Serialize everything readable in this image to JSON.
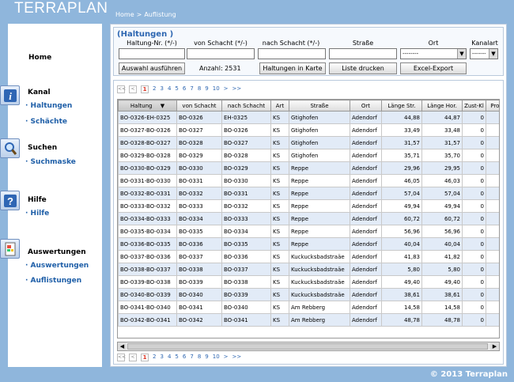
{
  "app": {
    "logo": "TERRAPLAN",
    "copyright": "© 2013 Terraplan"
  },
  "breadcrumb": [
    "Home",
    ">",
    "Auflistung"
  ],
  "sidebar": {
    "home": "Home",
    "groups": [
      {
        "title": "Kanal",
        "icon": "info-icon",
        "links": [
          "· Haltungen",
          "· Schächte"
        ]
      },
      {
        "title": "Suchen",
        "icon": "magnifier-icon",
        "links": [
          "· Suchmaske"
        ]
      },
      {
        "title": "Hilfe",
        "icon": "help-icon",
        "links": [
          "· Hilfe"
        ]
      },
      {
        "title": "Auswertungen",
        "icon": "report-icon",
        "links": [
          "· Auswertungen",
          "· Auflistungen"
        ]
      }
    ]
  },
  "filter": {
    "title": "(Haltungen )",
    "labels": [
      "Haltung-Nr. (*/-)",
      "von Schacht (*/-)",
      "nach Schacht (*/-)",
      "Straße",
      "Ort",
      "Kanalart"
    ],
    "ort_value": "--------",
    "kanalart_value": "-------",
    "buttons": [
      "Auswahl ausführen",
      "Haltungen in Karte",
      "Liste drucken",
      "Excel-Export"
    ],
    "count_label": "Anzahl: 2531"
  },
  "pager": {
    "prev_first": "<<",
    "prev": "<",
    "pages": [
      "1",
      "2",
      "3",
      "4",
      "5",
      "6",
      "7",
      "8",
      "9",
      "10"
    ],
    "current": "1",
    "next": ">",
    "next_last": ">>"
  },
  "table": {
    "columns": [
      "Haltung",
      "von Schacht",
      "nach Schacht",
      "Art",
      "Straße",
      "Ort",
      "Länge Str.",
      "Länge Hor.",
      "Zust-Kl",
      "Profil"
    ],
    "rows": [
      [
        "BO-0326-EH-0325",
        "BO-0326",
        "EH-0325",
        "KS",
        "Gtighofen",
        "Adendorf",
        "44,88",
        "44,87",
        "0"
      ],
      [
        "BO-0327-BO-0326",
        "BO-0327",
        "BO-0326",
        "KS",
        "Gtighofen",
        "Adendorf",
        "33,49",
        "33,48",
        "0"
      ],
      [
        "BO-0328-BO-0327",
        "BO-0328",
        "BO-0327",
        "KS",
        "Gtighofen",
        "Adendorf",
        "31,57",
        "31,57",
        "0"
      ],
      [
        "BO-0329-BO-0328",
        "BO-0329",
        "BO-0328",
        "KS",
        "Gtighofen",
        "Adendorf",
        "35,71",
        "35,70",
        "0"
      ],
      [
        "BO-0330-BO-0329",
        "BO-0330",
        "BO-0329",
        "KS",
        "Reppe",
        "Adendorf",
        "29,96",
        "29,95",
        "0"
      ],
      [
        "BO-0331-BO-0330",
        "BO-0331",
        "BO-0330",
        "KS",
        "Reppe",
        "Adendorf",
        "46,05",
        "46,03",
        "0"
      ],
      [
        "BO-0332-BO-0331",
        "BO-0332",
        "BO-0331",
        "KS",
        "Reppe",
        "Adendorf",
        "57,04",
        "57,04",
        "0"
      ],
      [
        "BO-0333-BO-0332",
        "BO-0333",
        "BO-0332",
        "KS",
        "Reppe",
        "Adendorf",
        "49,94",
        "49,94",
        "0"
      ],
      [
        "BO-0334-BO-0333",
        "BO-0334",
        "BO-0333",
        "KS",
        "Reppe",
        "Adendorf",
        "60,72",
        "60,72",
        "0"
      ],
      [
        "BO-0335-BO-0334",
        "BO-0335",
        "BO-0334",
        "KS",
        "Reppe",
        "Adendorf",
        "56,96",
        "56,96",
        "0"
      ],
      [
        "BO-0336-BO-0335",
        "BO-0336",
        "BO-0335",
        "KS",
        "Reppe",
        "Adendorf",
        "40,04",
        "40,04",
        "0"
      ],
      [
        "BO-0337-BO-0336",
        "BO-0337",
        "BO-0336",
        "KS",
        "Kuckucksbadstraäe",
        "Adendorf",
        "41,83",
        "41,82",
        "0"
      ],
      [
        "BO-0338-BO-0337",
        "BO-0338",
        "BO-0337",
        "KS",
        "Kuckucksbadstraäe",
        "Adendorf",
        "5,80",
        "5,80",
        "0"
      ],
      [
        "BO-0339-BO-0338",
        "BO-0339",
        "BO-0338",
        "KS",
        "Kuckucksbadstraäe",
        "Adendorf",
        "49,40",
        "49,40",
        "0"
      ],
      [
        "BO-0340-BO-0339",
        "BO-0340",
        "BO-0339",
        "KS",
        "Kuckucksbadstraäe",
        "Adendorf",
        "38,61",
        "38,61",
        "0"
      ],
      [
        "BO-0341-BO-0340",
        "BO-0341",
        "BO-0340",
        "KS",
        "Am Rebberg",
        "Adendorf",
        "14,58",
        "14,58",
        "0"
      ],
      [
        "BO-0342-BO-0341",
        "BO-0342",
        "BO-0341",
        "KS",
        "Am Rebberg",
        "Adendorf",
        "48,78",
        "48,78",
        "0"
      ]
    ]
  }
}
